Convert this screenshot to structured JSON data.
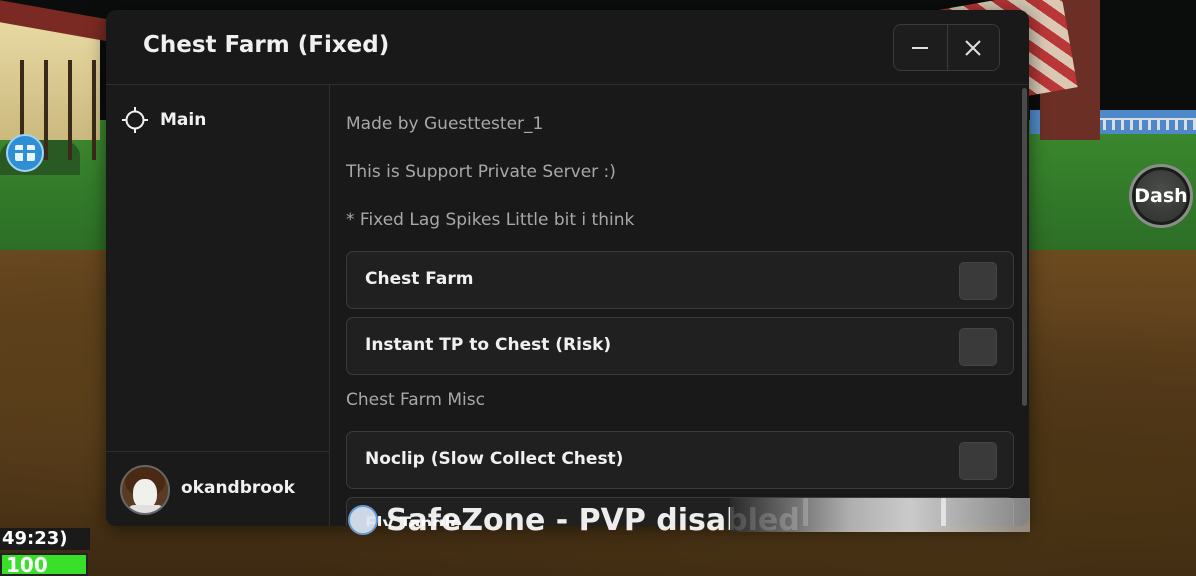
{
  "window": {
    "title": "Chest Farm (Fixed)",
    "minimize_icon": "minus-icon",
    "close_icon": "close-icon"
  },
  "sidebar": {
    "items": [
      {
        "label": "Main",
        "icon": "crosshair-icon",
        "active": true
      }
    ],
    "user": {
      "name": "okandbrook",
      "avatar": "avatar-icon"
    }
  },
  "content": {
    "paragraphs": [
      "Made by Guesttester_1",
      "This is Support Private Server :)",
      "* Fixed Lag Spikes Little bit i think"
    ],
    "toggles": [
      {
        "label": "Chest Farm",
        "checked": false
      },
      {
        "label": "Instant TP to Chest (Risk)",
        "checked": false
      }
    ],
    "section": "Chest Farm Misc",
    "misc_toggles": [
      {
        "label": "Noclip (Slow Collect Chest)",
        "checked": false
      }
    ],
    "partial_item": "Fly Tangle"
  },
  "hud": {
    "dash_label": "Dash",
    "timer_text": "49:23)",
    "health_text": "100",
    "health_fraction": 1.0,
    "safezone_text": "SafeZone - PVP disabled",
    "gift_icon": "gift-icon",
    "shield_icon": "shield-icon"
  },
  "colors": {
    "window_bg": "#191919",
    "row_bg": "#202020",
    "border": "#3a3a3a",
    "text_primary": "#f0f0f0",
    "text_secondary": "#a8a8a8",
    "health": "#39e02a"
  }
}
